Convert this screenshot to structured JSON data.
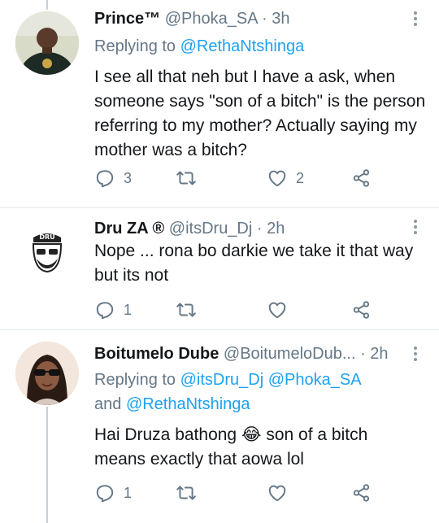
{
  "tweets": [
    {
      "name": "Prince™",
      "handle": "@Phoka_SA",
      "sep": " · ",
      "time": "3h",
      "replying_prefix": "Replying to ",
      "replying_to": "@RethaNtshinga",
      "text": "I see all that neh  but I have a ask, when someone says \"son of a bitch\" is the person referring to my mother?  Actually saying my mother was a bitch?",
      "reply_count": "3",
      "like_count": "2"
    },
    {
      "name": "Dru ZA ®",
      "handle": "@itsDru_Dj",
      "sep": " · ",
      "time": "2h",
      "text": "Nope ... rona bo darkie we take it that way but its not",
      "reply_count": "1",
      "like_count": ""
    },
    {
      "name": "Boitumelo Dube",
      "handle": "@BoitumeloDub...",
      "sep": " · ",
      "time": "2h",
      "replying_prefix": "Replying to ",
      "replying_to_1": "@itsDru_Dj",
      "replying_to_2": "@Phoka_SA",
      "replying_and": "and ",
      "replying_to_3": "@RethaNtshinga",
      "text_before_emoji": "Hai Druza bathong ",
      "emoji": "😂",
      "text_after_emoji": " son of a bitch means exactly that aowa lol",
      "reply_count": "1",
      "like_count": ""
    }
  ],
  "avatar_text": "DRU",
  "icons": [
    "reply-icon",
    "retweet-icon",
    "like-icon",
    "share-icon",
    "more-menu-icon"
  ],
  "colors": {
    "link": "#1da1f2",
    "muted": "#657786",
    "divider": "#e1e8ed"
  }
}
